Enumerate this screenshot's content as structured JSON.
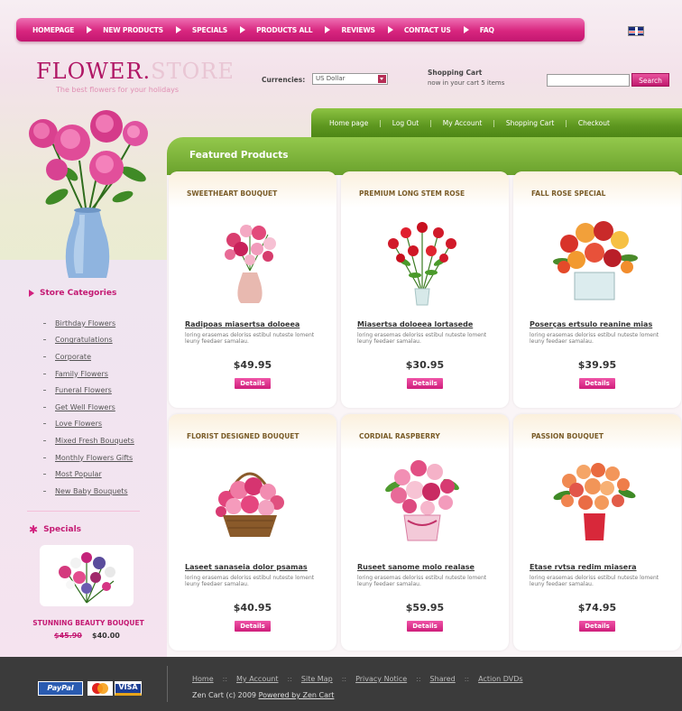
{
  "nav": {
    "items": [
      {
        "label": "HOMEPAGE"
      },
      {
        "label": "NEW PRODUCTS"
      },
      {
        "label": "SPECIALS"
      },
      {
        "label": "PRODUCTS ALL"
      },
      {
        "label": "REVIEWS"
      },
      {
        "label": "CONTACT US"
      },
      {
        "label": "FAQ"
      }
    ]
  },
  "logo": {
    "part1": "FLOWER.",
    "part2": "STORE",
    "tagline": "The best flowers for your holidays"
  },
  "currency": {
    "label": "Currencies:",
    "selected": "US Dollar"
  },
  "cart": {
    "title": "Shopping Cart",
    "text": "now in your cart 5 items"
  },
  "search": {
    "button": "Search",
    "placeholder": ""
  },
  "green_nav": [
    "Home page",
    "Log Out",
    "My Account",
    "Shopping Cart",
    "Checkout"
  ],
  "featured_title": "Featured Products",
  "sidebar": {
    "categories_title": "Store Categories",
    "categories": [
      "Birthday Flowers",
      "Congratulations",
      "Corporate",
      "Family Flowers",
      "Funeral Flowers",
      "Get Well Flowers",
      "Love Flowers",
      "Mixed Fresh Bouquets",
      "Monthly Flowers Gifts",
      "Most Popular",
      "New Baby Bouquets"
    ],
    "specials_title": "Specials",
    "special": {
      "name": "STUNNING BEAUTY BOUQUET",
      "old_price": "$45.90",
      "new_price": "$40.00"
    }
  },
  "products": [
    {
      "title": "SWEETHEART BOUQUET",
      "name": "Radipoas miasertsa doloeea",
      "desc": "loring erasemas deloriss estibul nuteste loment leuny feedaer samalau.",
      "price": "$49.95",
      "button": "Details"
    },
    {
      "title": "PREMIUM LONG STEM ROSE",
      "name": "Miasertsa doloeea lortasede",
      "desc": "loring erasemas deloriss estibul nuteste loment leuny feedaer samalau.",
      "price": "$30.95",
      "button": "Details"
    },
    {
      "title": "FALL ROSE SPECIAL",
      "name": "Poserças ertsulo reanine mias",
      "desc": "loring erasemas deloriss estibul nuteste loment leuny feedaer samalau.",
      "price": "$39.95",
      "button": "Details"
    },
    {
      "title": "FLORIST DESIGNED BOUQUET",
      "name": "Laseet sanaseia dolor psamas",
      "desc": "loring erasemas deloriss estibul nuteste loment leuny feedaer samalau.",
      "price": "$40.95",
      "button": "Details"
    },
    {
      "title": "CORDIAL RASPBERRY",
      "name": "Ruseet sanome molo realase",
      "desc": "loring erasemas deloriss estibul nuteste loment leuny feedaer samalau.",
      "price": "$59.95",
      "button": "Details"
    },
    {
      "title": "PASSION BOUQUET",
      "name": "Etase rvtsa redim miasera",
      "desc": "loring erasemas deloriss estibul nuteste loment leuny feedaer samalau.",
      "price": "$74.95",
      "button": "Details"
    }
  ],
  "footer": {
    "payments": [
      "PayPal",
      "",
      "VISA"
    ],
    "links": [
      "Home",
      "My Account",
      "Site Map",
      "Privacy Notice",
      "Shared",
      "Action DVDs"
    ],
    "copyright": "Zen Cart (c) 2009",
    "powered": "Powered by Zen Cart"
  },
  "colors": {
    "pink": "#c31670",
    "green": "#6aa12c",
    "footer": "#3b3b3b"
  }
}
